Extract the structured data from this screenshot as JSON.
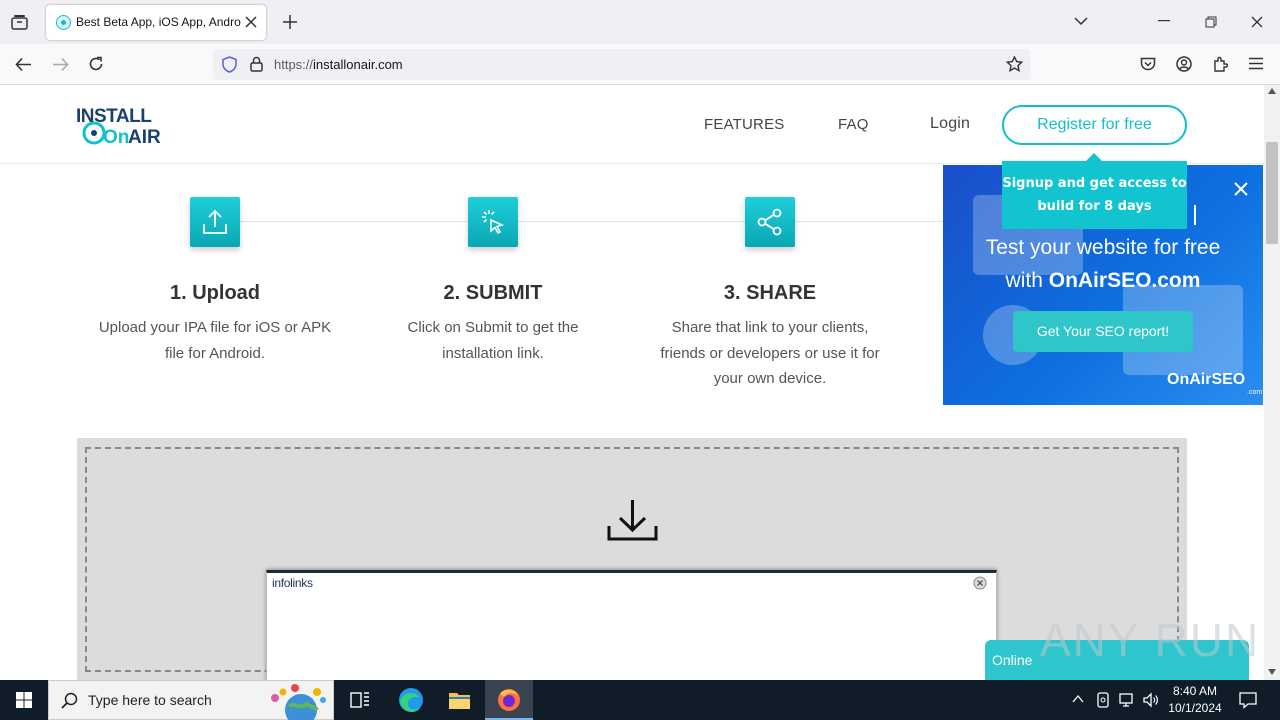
{
  "browser": {
    "tab_title": "Best Beta App, iOS App, Android",
    "url_prefix": "https://",
    "url_domain": "installonair.com"
  },
  "site": {
    "logo_top": "INSTALL",
    "logo_bottom_a": "On",
    "logo_bottom_b": "AIR",
    "nav": {
      "features": "FEATURES",
      "faq": "FAQ",
      "login": "Login",
      "register": "Register for free"
    },
    "tooltip": "Signup and get access to build for 8 days",
    "steps": [
      {
        "title": "1. Upload",
        "desc": "Upload your IPA file for iOS or APK file for Android.",
        "icon": "upload-icon"
      },
      {
        "title": "2. SUBMIT",
        "desc": "Click on Submit to get the installation link.",
        "icon": "click-icon"
      },
      {
        "title": "3. SHARE",
        "desc": "Share that link to your clients, friends or developers or use it for your own device.",
        "icon": "share-icon"
      }
    ]
  },
  "ad": {
    "line1": "Test your website for free",
    "line2_pre": "with ",
    "line2_bold": "OnAirSEO.com",
    "cta": "Get Your SEO report!",
    "logo": "OnAirSEO",
    "logo_sub": ".com"
  },
  "infolinks": {
    "brand": "infolinks"
  },
  "chat": {
    "label": "Online"
  },
  "watermark": "ANY RUN",
  "taskbar": {
    "search_placeholder": "Type here to search",
    "time": "8:40 AM",
    "date": "10/1/2024"
  },
  "colors": {
    "accent": "#12c0cc",
    "ad_blue": "#1a5fd8",
    "taskbar": "#101c28"
  }
}
